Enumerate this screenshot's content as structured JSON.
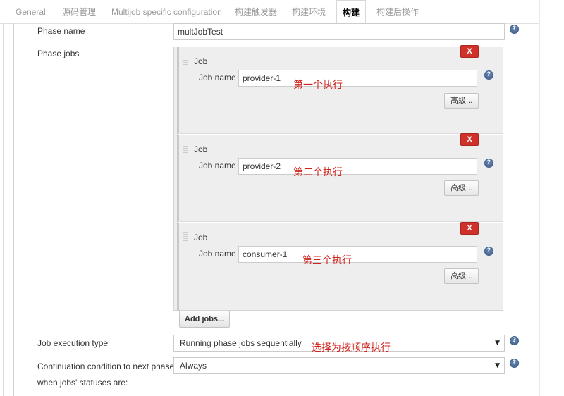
{
  "tabs": [
    {
      "label": "General",
      "active": false
    },
    {
      "label": "源码管理",
      "active": false
    },
    {
      "label": "Multijob specific configuration",
      "active": false
    },
    {
      "label": "构建触发器",
      "active": false
    },
    {
      "label": "构建环境",
      "active": false
    },
    {
      "label": "构建",
      "active": true
    },
    {
      "label": "构建后操作",
      "active": false
    }
  ],
  "phase": {
    "name_label": "Phase name",
    "name_value": "multJobTest",
    "jobs_label": "Phase jobs",
    "jobs": [
      {
        "header": "Job",
        "name_label": "Job name",
        "name_value": "provider-1",
        "note": "第一个执行",
        "advanced_label": "高级...",
        "delete_label": "X"
      },
      {
        "header": "Job",
        "name_label": "Job name",
        "name_value": "provider-2",
        "note": "第二个执行",
        "advanced_label": "高级...",
        "delete_label": "X"
      },
      {
        "header": "Job",
        "name_label": "Job name",
        "name_value": "consumer-1",
        "note": "第三个执行",
        "advanced_label": "高级...",
        "delete_label": "X"
      }
    ],
    "add_jobs_label": "Add jobs..."
  },
  "execution": {
    "label": "Job execution type",
    "value": "Running phase jobs sequentially",
    "note": "选择为按顺序执行"
  },
  "continuation": {
    "label_line1": "Continuation condition to next phase",
    "label_line2": "when jobs' statuses are:",
    "value": "Always"
  },
  "icons": {
    "help": "help-icon",
    "dropdown": "chevron-down-icon",
    "drag": "drag-handle-icon"
  },
  "colors": {
    "delete_button": "#d0322b",
    "annotation": "#d0211b",
    "help_icon": "#5b7ba8",
    "panel_background": "#eeeeee"
  }
}
